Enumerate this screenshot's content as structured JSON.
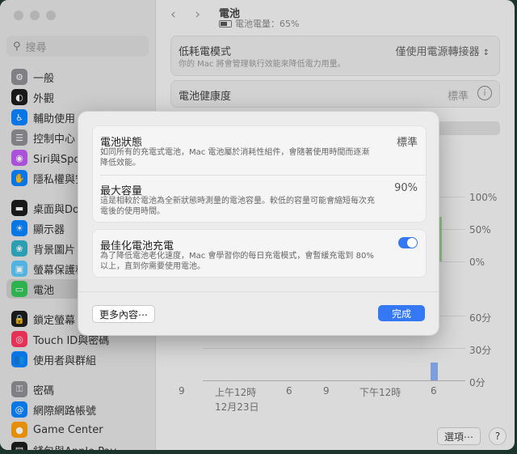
{
  "colors": {
    "accent": "#3478f6",
    "close": "#c8c8c8",
    "minimize": "#c8c8c8",
    "zoom": "#c8c8c8"
  },
  "sidebar": {
    "search_placeholder": "搜尋",
    "items": [
      {
        "label": "一般",
        "icon": "gear-icon",
        "color": "#8e8e93"
      },
      {
        "label": "外觀",
        "icon": "appearance-icon",
        "color": "#1c1c1e"
      },
      {
        "label": "輔助使用",
        "icon": "accessibility-icon",
        "color": "#0a84ff"
      },
      {
        "label": "控制中心",
        "icon": "control-center-icon",
        "color": "#8e8e93"
      },
      {
        "label": "Siri與Spotlight",
        "icon": "siri-icon",
        "color": "#bf5af2"
      },
      {
        "label": "隱私權與安全性",
        "icon": "privacy-hand-icon",
        "color": "#0a84ff"
      },
      {
        "label": "桌面與Dock",
        "icon": "dock-icon",
        "color": "#1c1c1e"
      },
      {
        "label": "顯示器",
        "icon": "display-icon",
        "color": "#0a84ff"
      },
      {
        "label": "背景圖片",
        "icon": "wallpaper-icon",
        "color": "#30b0c7"
      },
      {
        "label": "螢幕保護程式",
        "icon": "screensaver-icon",
        "color": "#5ac8fa"
      },
      {
        "label": "電池",
        "icon": "battery-icon",
        "color": "#34c759"
      },
      {
        "label": "鎖定螢幕",
        "icon": "lock-icon",
        "color": "#1c1c1e"
      },
      {
        "label": "Touch ID與密碼",
        "icon": "fingerprint-icon",
        "color": "#ff375f"
      },
      {
        "label": "使用者與群組",
        "icon": "users-icon",
        "color": "#0a84ff"
      },
      {
        "label": "密碼",
        "icon": "key-icon",
        "color": "#8e8e93"
      },
      {
        "label": "網際網路帳號",
        "icon": "at-icon",
        "color": "#0a84ff"
      },
      {
        "label": "Game Center",
        "icon": "game-center-icon",
        "color": "#ff9f0a"
      },
      {
        "label": "錢包與Apple Pay",
        "icon": "wallet-icon",
        "color": "#1c1c1e"
      }
    ]
  },
  "header": {
    "title": "電池",
    "subtitle": "電池電量：65%",
    "battery_level": 0.65
  },
  "low_power": {
    "title": "低耗電模式",
    "description": "你的 Mac 將會管理執行效能來降低電力用量。",
    "value": "僅使用電源轉接器"
  },
  "health": {
    "title": "電池健康度",
    "value": "標準"
  },
  "chart": {
    "pct_ticks": [
      "100%",
      "50%",
      "0%"
    ],
    "min_ticks": [
      "60分",
      "30分",
      "0分"
    ],
    "x_labels": [
      "9",
      "上午12時",
      "6",
      "9",
      "下午12時",
      "6"
    ],
    "date_label": "12月23日"
  },
  "bottom": {
    "options_label": "選項⋯",
    "help_label": "?"
  },
  "dialog": {
    "rows": [
      {
        "title": "電池狀態",
        "value": "標準",
        "desc": "如同所有的充電式電池，Mac 電池屬於消耗性組件，會隨著使用時間而逐漸降低效能。"
      },
      {
        "title": "最大容量",
        "value": "90%",
        "desc": "這是相較於電池為全新狀態時測量的電池容量。較低的容量可能會縮短每次充電後的使用時間。"
      }
    ],
    "optimized": {
      "title": "最佳化電池充電",
      "desc": "為了降低電池老化速度，Mac 會學習你的每日充電模式，會暫緩充電到 80% 以上，直到你需要使用電池。",
      "enabled": true
    },
    "more_label": "更多內容⋯",
    "done_label": "完成"
  }
}
